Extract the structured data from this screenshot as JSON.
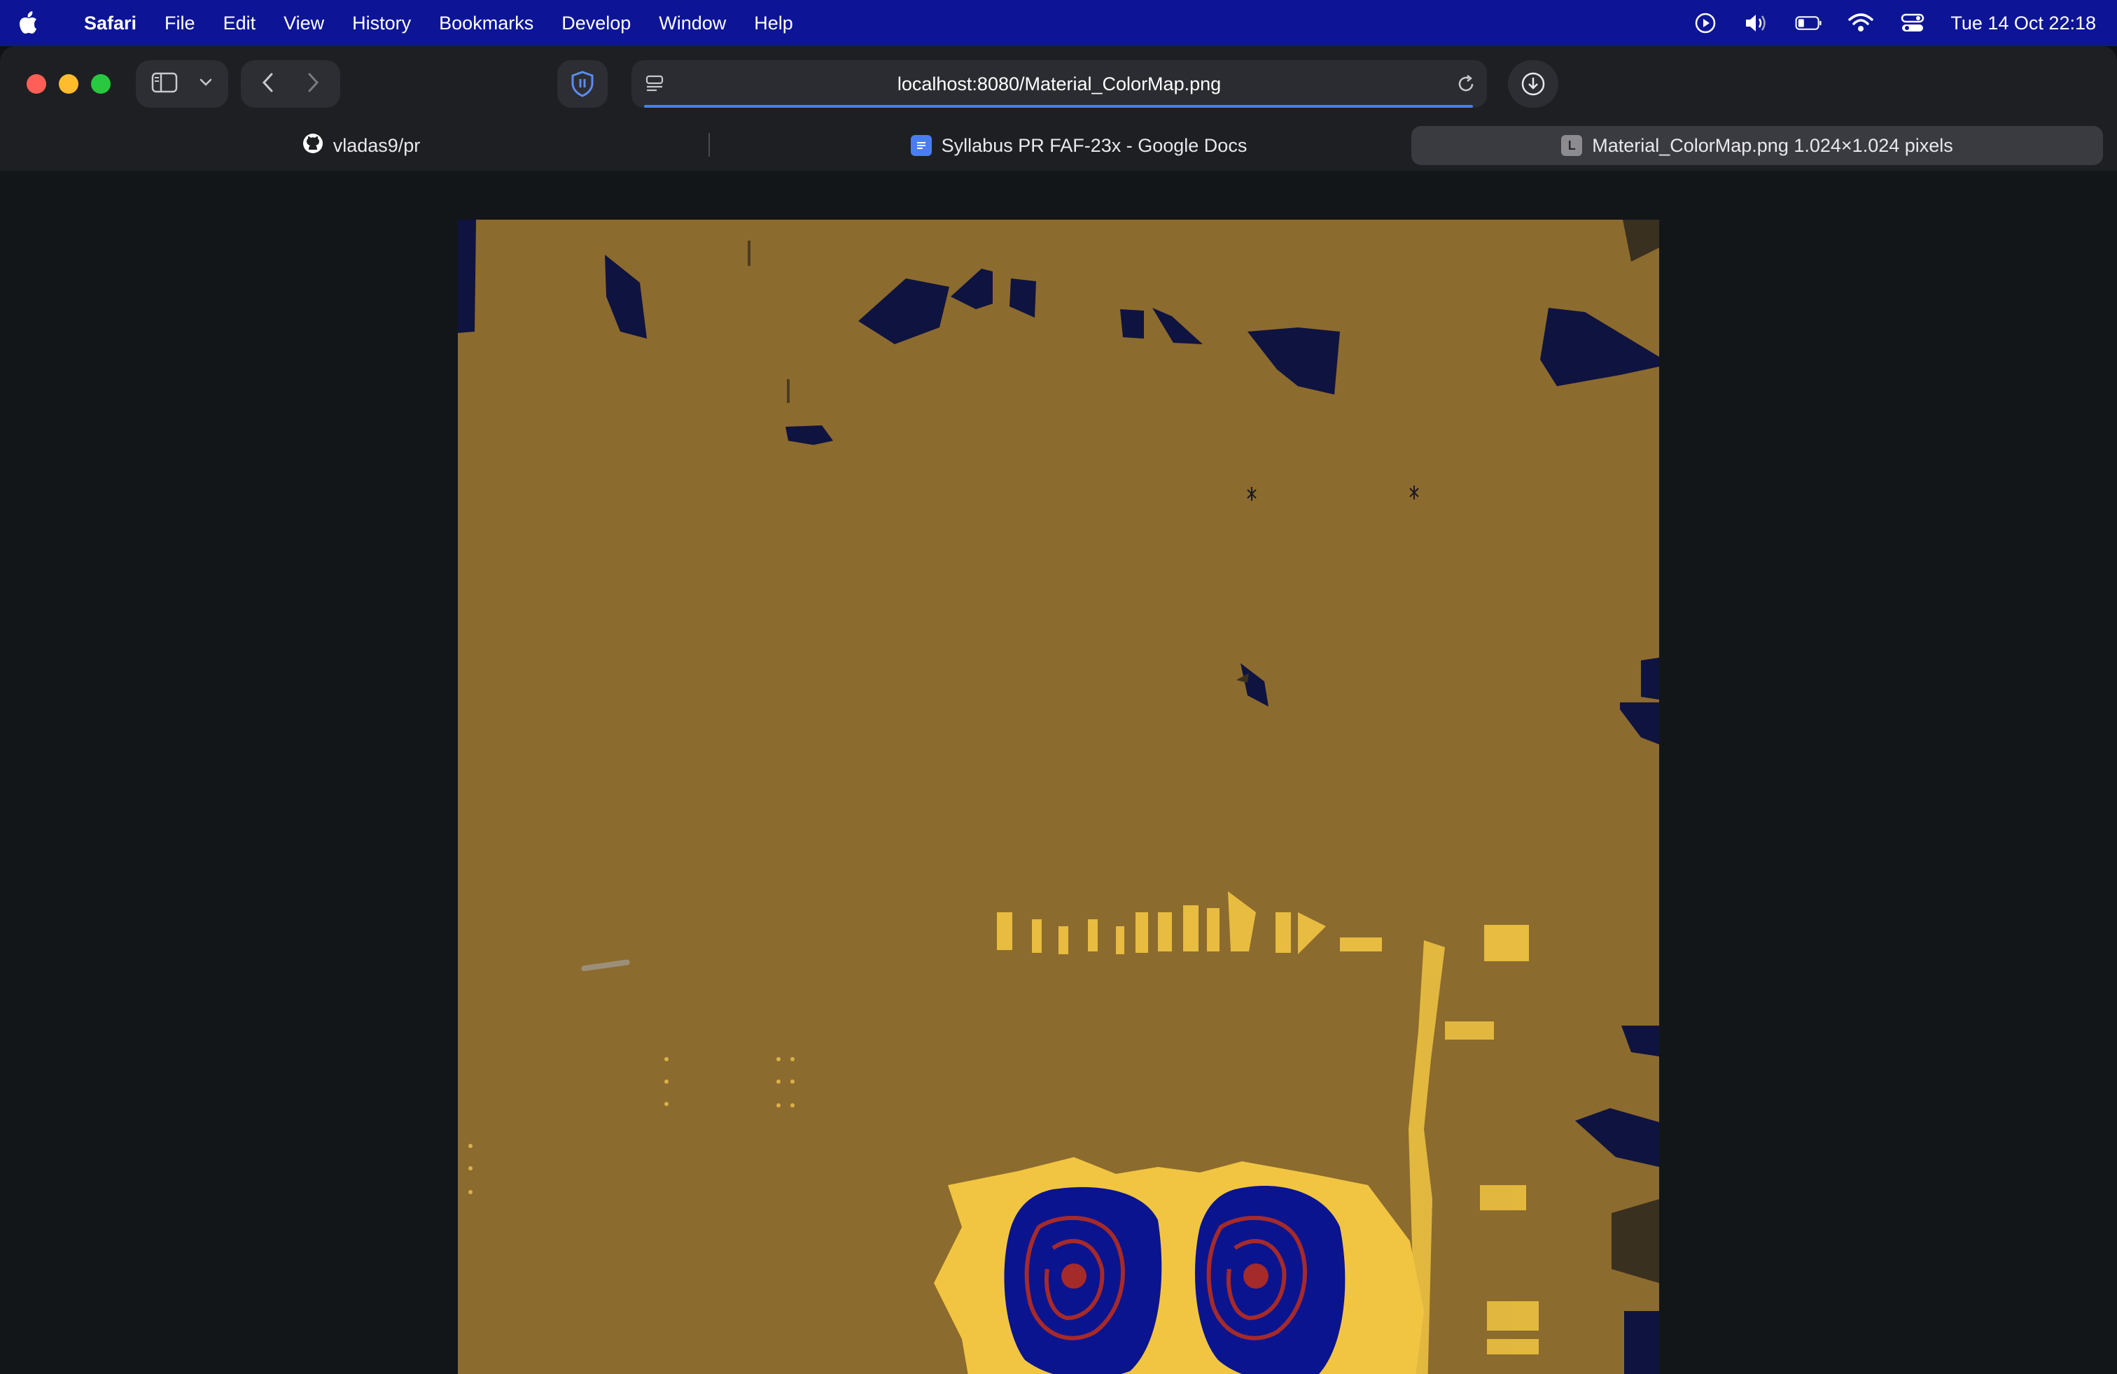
{
  "menubar": {
    "app_name": "Safari",
    "items": [
      "File",
      "Edit",
      "View",
      "History",
      "Bookmarks",
      "Develop",
      "Window",
      "Help"
    ],
    "clock": "Tue 14 Oct  22:18",
    "status_icons": [
      "play-icon",
      "volume-icon",
      "battery-icon",
      "wifi-icon",
      "control-center-icon"
    ]
  },
  "toolbar": {
    "address": "localhost:8080/Material_ColorMap.png"
  },
  "tabs": [
    {
      "title": "vladas9/pr",
      "icon": "github-icon"
    },
    {
      "title": "Syllabus PR FAF-23x - Google Docs",
      "icon": "google-docs-icon"
    },
    {
      "title": "Material_ColorMap.png 1.024×1.024 pixels",
      "icon": "image-file-icon",
      "favicon_letter": "L",
      "active": true
    }
  ],
  "image": {
    "alt": "Material_ColorMap.png",
    "colors": {
      "base": "#8c6b2e",
      "dark": "#0f1340",
      "yellow": "#f1c542",
      "blue": "#0a148f",
      "red": "#a52a2a"
    }
  },
  "colors": {
    "menubar": "#0d1596",
    "window": "#1e1f23",
    "content_bg": "#121619",
    "accent": "#3f82f0"
  }
}
